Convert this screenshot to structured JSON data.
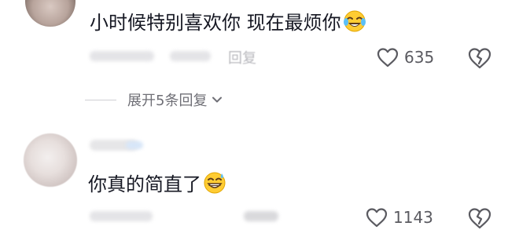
{
  "comments": [
    {
      "text": "小时候特别喜欢你 现在最烦你",
      "emoji_icon": "face-with-tears-of-joy-icon",
      "reply_label": "回复",
      "like_count": "635",
      "expand_label": "展开5条回复"
    },
    {
      "text": "你真的简直了",
      "emoji_icon": "grinning-face-with-sweat-icon",
      "like_count": "1143"
    }
  ],
  "colors": {
    "text": "#161823",
    "muted": "#6f6f76",
    "icon": "#5a5a60",
    "emoji_yellow": "#ffcc33"
  }
}
